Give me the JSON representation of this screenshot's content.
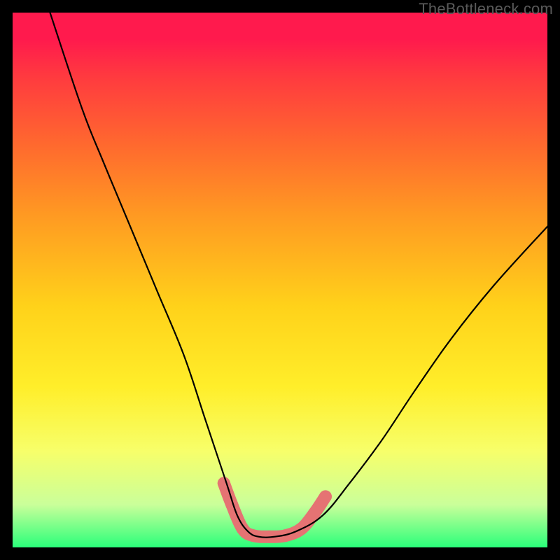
{
  "watermark": "TheBottleneck.com",
  "chart_data": {
    "type": "line",
    "title": "",
    "xlabel": "",
    "ylabel": "",
    "xlim": [
      0,
      100
    ],
    "ylim": [
      0,
      100
    ],
    "series": [
      {
        "name": "curve",
        "x": [
          7,
          13,
          17,
          22,
          27,
          32,
          36,
          40,
          42,
          44,
          46,
          49,
          53,
          58,
          63,
          69,
          75,
          82,
          90,
          100
        ],
        "y": [
          100,
          82,
          72,
          60,
          48,
          36,
          24,
          12,
          6,
          3,
          2,
          2,
          3,
          6,
          12,
          20,
          29,
          39,
          49,
          60
        ]
      },
      {
        "name": "highlight",
        "x": [
          39.5,
          41,
          43,
          45,
          48,
          51,
          54,
          56.5,
          58.5
        ],
        "y": [
          12,
          8,
          3.5,
          2.2,
          2,
          2.2,
          3.5,
          6.5,
          9.5
        ]
      }
    ],
    "colors": {
      "curve": "#000000",
      "highlight": "#e57373",
      "gradient_top": "#ff1a4d",
      "gradient_bottom": "#2aff7a"
    }
  }
}
